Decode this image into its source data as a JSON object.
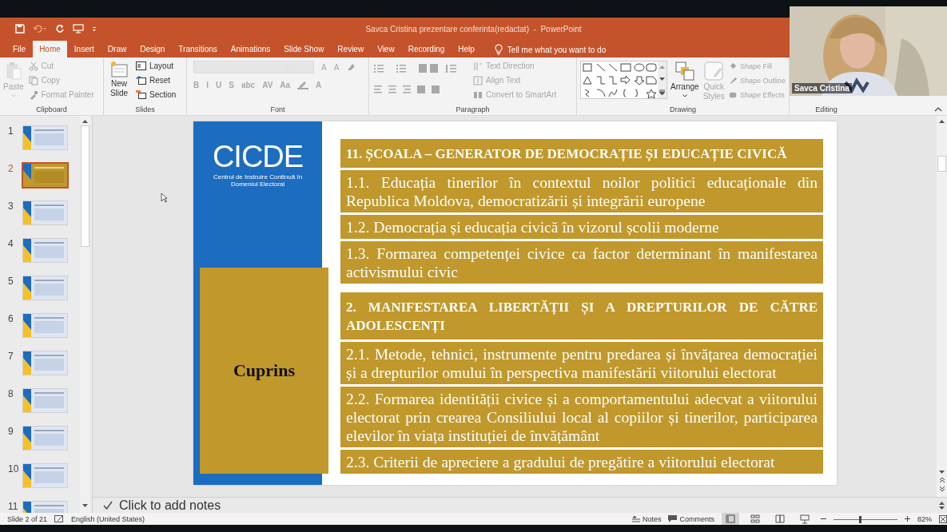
{
  "window": {
    "title": "Savca Cristina prezentare conferinta(redactat)  -  PowerPoint"
  },
  "tabs": [
    {
      "label": "File",
      "selected": false
    },
    {
      "label": "Home",
      "selected": true
    },
    {
      "label": "Insert",
      "selected": false
    },
    {
      "label": "Draw",
      "selected": false
    },
    {
      "label": "Design",
      "selected": false
    },
    {
      "label": "Transitions",
      "selected": false
    },
    {
      "label": "Animations",
      "selected": false
    },
    {
      "label": "Slide Show",
      "selected": false
    },
    {
      "label": "Review",
      "selected": false
    },
    {
      "label": "View",
      "selected": false
    },
    {
      "label": "Recording",
      "selected": false
    },
    {
      "label": "Help",
      "selected": false
    }
  ],
  "tell_me": {
    "placeholder": "Tell me what you want to do"
  },
  "ribbon": {
    "clipboard": {
      "label": "Clipboard",
      "paste": {
        "label": "Paste",
        "disabled": true
      },
      "cut": {
        "label": "Cut",
        "disabled": true
      },
      "copy": {
        "label": "Copy",
        "disabled": true
      },
      "format_painter": {
        "label": "Format Painter",
        "disabled": true
      }
    },
    "slides": {
      "label": "Slides",
      "new_slide": {
        "label": "New Slide",
        "disabled": false
      },
      "layout": {
        "label": "Layout",
        "disabled": false
      },
      "reset": {
        "label": "Reset",
        "disabled": false
      },
      "section": {
        "label": "Section",
        "disabled": false
      }
    },
    "font": {
      "label": "Font",
      "disabled": true,
      "size_buttons": [
        "A",
        "A"
      ],
      "format_buttons": [
        "B",
        "I",
        "U",
        "S",
        "abc",
        "AV",
        "Aa"
      ],
      "color_button": "A"
    },
    "paragraph": {
      "label": "Paragraph",
      "disabled": true,
      "text_direction": "Text Direction",
      "align_text": "Align Text",
      "convert": "Convert to SmartArt"
    },
    "drawing": {
      "label": "Drawing",
      "arrange": {
        "label": "Arrange",
        "disabled": false
      },
      "quick_styles": {
        "label": "Quick Styles",
        "disabled": true
      },
      "shape_fill": {
        "label": "Shape Fill",
        "disabled": true
      },
      "shape_outline": {
        "label": "Shape Outline",
        "disabled": true
      },
      "shape_effects": {
        "label": "Shape Effects",
        "disabled": true
      }
    },
    "editing": {
      "label": "Editing"
    }
  },
  "thumbnails": [
    {
      "number": "1",
      "selected": false
    },
    {
      "number": "2",
      "selected": true
    },
    {
      "number": "3",
      "selected": false
    },
    {
      "number": "4",
      "selected": false
    },
    {
      "number": "5",
      "selected": false
    },
    {
      "number": "6",
      "selected": false
    },
    {
      "number": "7",
      "selected": false
    },
    {
      "number": "8",
      "selected": false
    },
    {
      "number": "9",
      "selected": false
    },
    {
      "number": "10",
      "selected": false
    },
    {
      "number": "11",
      "selected": false
    }
  ],
  "slide": {
    "logo": "CICDE",
    "logo_subtitle": "Centrul de Instruire Continuă în Domeniul Electoral",
    "box_title": "Cuprins",
    "rows": [
      {
        "kind": "heading",
        "text": "11. ȘCOALA – GENERATOR DE DEMOCRAȚIE ȘI EDUCAȚIE CIVICĂ"
      },
      {
        "kind": "item",
        "text": "1.1. Educația tinerilor în contextul noilor politici educaționale  din Republica Moldova, democratizării și integrării europene"
      },
      {
        "kind": "item",
        "text": "1.2. Democrația și educația civică în vizorul școlii moderne"
      },
      {
        "kind": "item",
        "text": "1.3. Formarea  competenței civice ca factor determinant în manifestarea activismului civic"
      },
      {
        "kind": "heading",
        "text": "2. MANIFESTAREA LIBERTĂȚII ȘI A DREPTURILOR DE CĂTRE ADOLESCENȚI"
      },
      {
        "kind": "item",
        "text": "2.1. Metode, tehnici, instrumente pentru predarea și învățarea democrației și a drepturilor omului în perspectiva manifestării viitorului electorat"
      },
      {
        "kind": "item",
        "text": "2.2. Formarea identității civice și a comportamentului adecvat a viitorului electorat prin crearea Consiliului local al copiilor și tinerilor, participarea elevilor în viața instituției de învățământ"
      },
      {
        "kind": "item",
        "text": "2.3. Criterii de apreciere a gradului de pregătire a viitorului electorat"
      }
    ]
  },
  "notes": {
    "placeholder": "Click to add notes"
  },
  "status_bar": {
    "slide_position": "Slide 2 of 21",
    "language": "English (United States)",
    "notes": "Notes",
    "comments": "Comments",
    "zoom": {
      "level": 0.4
    },
    "zoom_percent": "82%"
  },
  "video_overlay": {
    "name_label": "Savca Cristina"
  }
}
